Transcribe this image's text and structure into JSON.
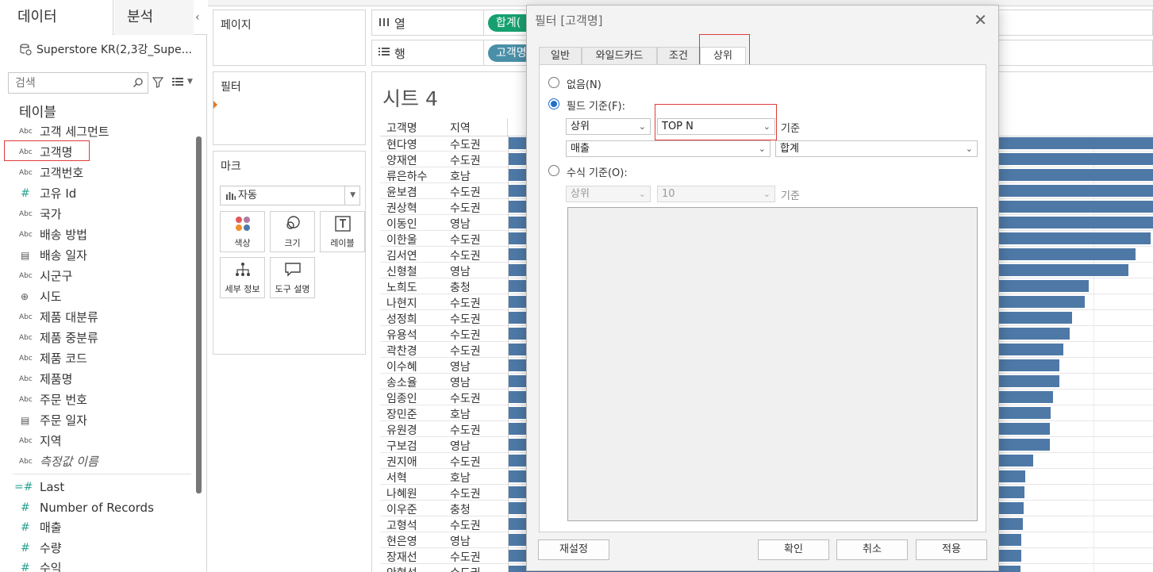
{
  "left_pane": {
    "tab_data": "데이터",
    "tab_analysis": "분석",
    "datasource": "Superstore KR(2,3강_Supe...",
    "search_placeholder": "검색",
    "tables_heading": "테이블",
    "fields": [
      {
        "icon": "Abc",
        "label": "고객 세그먼트",
        "kind": "dim"
      },
      {
        "icon": "Abc",
        "label": "고객명",
        "kind": "dim"
      },
      {
        "icon": "Abc",
        "label": "고객번호",
        "kind": "dim"
      },
      {
        "icon": "#",
        "label": "고유 Id",
        "kind": "dimnum"
      },
      {
        "icon": "Abc",
        "label": "국가",
        "kind": "dim"
      },
      {
        "icon": "Abc",
        "label": "배송 방법",
        "kind": "dim"
      },
      {
        "icon": "cal",
        "label": "배송 일자",
        "kind": "date"
      },
      {
        "icon": "Abc",
        "label": "시군구",
        "kind": "dim"
      },
      {
        "icon": "globe",
        "label": "시도",
        "kind": "geo"
      },
      {
        "icon": "Abc",
        "label": "제품 대분류",
        "kind": "dim"
      },
      {
        "icon": "Abc",
        "label": "제품 중분류",
        "kind": "dim"
      },
      {
        "icon": "Abc",
        "label": "제품 코드",
        "kind": "dim"
      },
      {
        "icon": "Abc",
        "label": "제품명",
        "kind": "dim"
      },
      {
        "icon": "Abc",
        "label": "주문 번호",
        "kind": "dim"
      },
      {
        "icon": "cal",
        "label": "주문 일자",
        "kind": "date"
      },
      {
        "icon": "Abc",
        "label": "지역",
        "kind": "dim"
      },
      {
        "icon": "Abc",
        "label": "측정값 이름",
        "kind": "italic"
      }
    ],
    "measures": [
      {
        "icon": "=#",
        "label": "Last"
      },
      {
        "icon": "#",
        "label": "Number of Records"
      },
      {
        "icon": "#",
        "label": "매출"
      },
      {
        "icon": "#",
        "label": "수량"
      },
      {
        "icon": "#",
        "label": "수익"
      }
    ]
  },
  "cards": {
    "pages": "페이지",
    "filters": "필터",
    "marks": "마크",
    "mark_type": "자동",
    "mark_buttons": {
      "color": "색상",
      "size": "크기",
      "label": "레이블",
      "detail": "세부 정보",
      "tooltip": "도구 설명"
    }
  },
  "shelves": {
    "columns_label": "열",
    "rows_label": "행",
    "columns_pill": "합계(",
    "rows_pill": "고객명"
  },
  "sheet": {
    "title": "시트 4",
    "col_name": "고객명",
    "col_region": "지역",
    "rows": [
      {
        "name": "현다영",
        "region": "수도권",
        "value": 100
      },
      {
        "name": "양재연",
        "region": "수도권",
        "value": 100
      },
      {
        "name": "류은하수",
        "region": "호남",
        "value": 100
      },
      {
        "name": "윤보겸",
        "region": "수도권",
        "value": 100
      },
      {
        "name": "권상혁",
        "region": "수도권",
        "value": 100
      },
      {
        "name": "이동인",
        "region": "영남",
        "value": 100
      },
      {
        "name": "이한울",
        "region": "수도권",
        "value": 98.7
      },
      {
        "name": "김서연",
        "region": "수도권",
        "value": 96.4
      },
      {
        "name": "신형철",
        "region": "영남",
        "value": 95.2
      },
      {
        "name": "노희도",
        "region": "충청",
        "value": 89.1
      },
      {
        "name": "나현지",
        "region": "수도권",
        "value": 88.5
      },
      {
        "name": "성정희",
        "region": "수도권",
        "value": 86.6
      },
      {
        "name": "유용석",
        "region": "수도권",
        "value": 86.2
      },
      {
        "name": "곽찬경",
        "region": "수도권",
        "value": 85.2
      },
      {
        "name": "이수혜",
        "region": "영남",
        "value": 84.6
      },
      {
        "name": "송소율",
        "region": "영남",
        "value": 84.6
      },
      {
        "name": "임종인",
        "region": "수도권",
        "value": 83.6
      },
      {
        "name": "장민준",
        "region": "호남",
        "value": 83.3
      },
      {
        "name": "유원경",
        "region": "수도권",
        "value": 83.2
      },
      {
        "name": "구보검",
        "region": "영남",
        "value": 83.2
      },
      {
        "name": "권지애",
        "region": "수도권",
        "value": 80.6
      },
      {
        "name": "서혁",
        "region": "호남",
        "value": 79.4
      },
      {
        "name": "나혜원",
        "region": "수도권",
        "value": 79.3
      },
      {
        "name": "이우준",
        "region": "충청",
        "value": 79.1
      },
      {
        "name": "고형석",
        "region": "수도권",
        "value": 79.0
      },
      {
        "name": "현은영",
        "region": "영남",
        "value": 78.8
      },
      {
        "name": "장재선",
        "region": "수도권",
        "value": 78.8
      },
      {
        "name": "안형석",
        "region": "수도권",
        "value": 78.6
      }
    ]
  },
  "dialog": {
    "title": "필터 [고객명]",
    "tabs": [
      "일반",
      "와일드카드",
      "조건",
      "상위"
    ],
    "active_tab": "상위",
    "opt_none": "없음(N)",
    "opt_field": "필드 기준(F):",
    "field_dir": "상위",
    "field_n": "TOP N",
    "field_by": "기준",
    "field_measure": "매출",
    "field_agg": "합계",
    "opt_formula": "수식 기준(O):",
    "formula_dir": "상위",
    "formula_n": "10",
    "formula_by": "기준",
    "btn_reset": "재설정",
    "btn_ok": "확인",
    "btn_cancel": "취소",
    "btn_apply": "적용"
  },
  "colors": {
    "bar": "#4e79a7",
    "column_pill": "#17a06f",
    "row_pill": "#4a8fa8",
    "highlight": "#e03b3b",
    "radio_selected": "#1f6fd1"
  }
}
